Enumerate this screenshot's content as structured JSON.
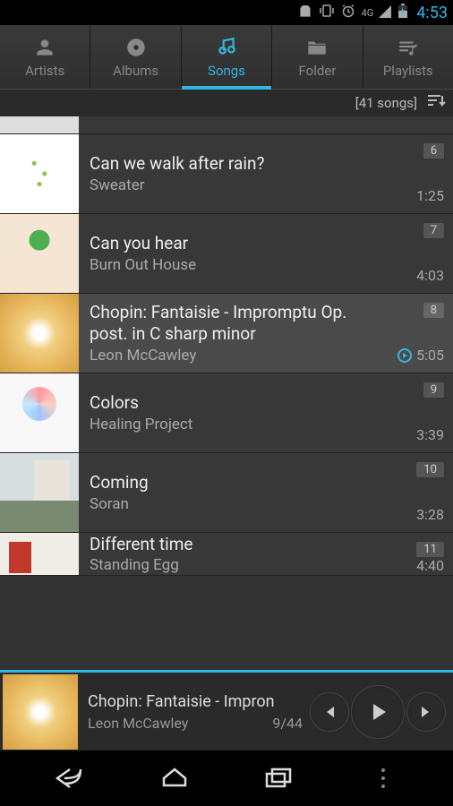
{
  "status": {
    "time": "4:53",
    "network": "4G"
  },
  "tabs": {
    "artists": "Artists",
    "albums": "Albums",
    "songs": "Songs",
    "folder": "Folder",
    "playlists": "Playlists",
    "active": "songs"
  },
  "summary": {
    "count": "[41 songs]"
  },
  "songs": [
    {
      "title": "Can we walk after rain?",
      "artist": "Sweater",
      "track": "6",
      "duration": "1:25",
      "playing": false
    },
    {
      "title": "Can you hear",
      "artist": "Burn Out House",
      "track": "7",
      "duration": "4:03",
      "playing": false
    },
    {
      "title": "Chopin: Fantaisie - Impromptu Op. post. in C sharp minor",
      "artist": "Leon McCawley",
      "track": "8",
      "duration": "5:05",
      "playing": true
    },
    {
      "title": "Colors",
      "artist": "Healing Project",
      "track": "9",
      "duration": "3:39",
      "playing": false
    },
    {
      "title": "Coming",
      "artist": "Soran",
      "track": "10",
      "duration": "3:28",
      "playing": false
    },
    {
      "title": "Different time",
      "artist": "Standing Egg",
      "track": "11",
      "duration": "4:40",
      "playing": false
    }
  ],
  "now_playing": {
    "title": "Chopin: Fantaisie - Impron",
    "artist": "Leon McCawley",
    "position": "9/44"
  }
}
